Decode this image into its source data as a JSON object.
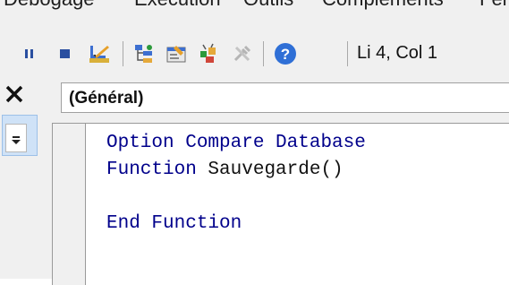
{
  "menu": {
    "items": [
      "Débogage",
      "Exécution",
      "Outils",
      "Compléments",
      "Fenêtre"
    ]
  },
  "toolbar": {
    "status": "Li 4, Col 1"
  },
  "object_combo": {
    "value": "(Général)"
  },
  "code": {
    "line1_kw": "Option Compare Database",
    "line2_kw": "Function",
    "line2_name": " Sauvegarde()",
    "line4_kw": "End Function"
  },
  "colors": {
    "keyword": "#00008b",
    "toolbar_bg": "#f0f0f0",
    "help_blue": "#2f6fd6"
  },
  "icons": [
    "pause-icon",
    "stop-icon",
    "design-mode-icon",
    "project-explorer-icon",
    "properties-icon",
    "object-browser-icon",
    "toolbox-icon",
    "help-icon",
    "close-icon"
  ]
}
